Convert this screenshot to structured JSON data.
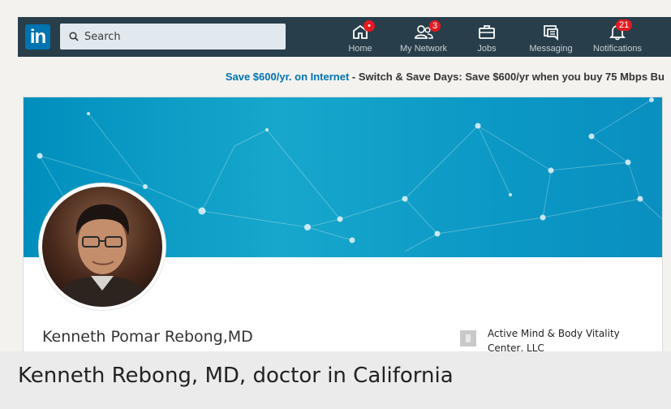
{
  "logo": "in",
  "search": {
    "placeholder": "Search"
  },
  "nav": [
    {
      "label": "Home",
      "badge": "•",
      "icon": "home-icon"
    },
    {
      "label": "My Network",
      "badge": "3",
      "icon": "network-icon"
    },
    {
      "label": "Jobs",
      "badge": "",
      "icon": "jobs-icon"
    },
    {
      "label": "Messaging",
      "badge": "",
      "icon": "messaging-icon"
    },
    {
      "label": "Notifications",
      "badge": "21",
      "icon": "bell-icon"
    }
  ],
  "ad": {
    "link": "Save $600/yr. on Internet",
    "text": " - Switch & Save Days: Save $600/yr when you buy 75 Mbps Bu"
  },
  "profile": {
    "name": "Kenneth Pomar Rebong,MD",
    "company": "Active Mind & Body Vitality Center, LLC"
  },
  "caption": "Kenneth Rebong, MD, doctor in California",
  "colors": {
    "topbar": "#283e4a",
    "brand": "#0073b1",
    "badge": "#e31b23",
    "banner": "#0f9cc7"
  }
}
